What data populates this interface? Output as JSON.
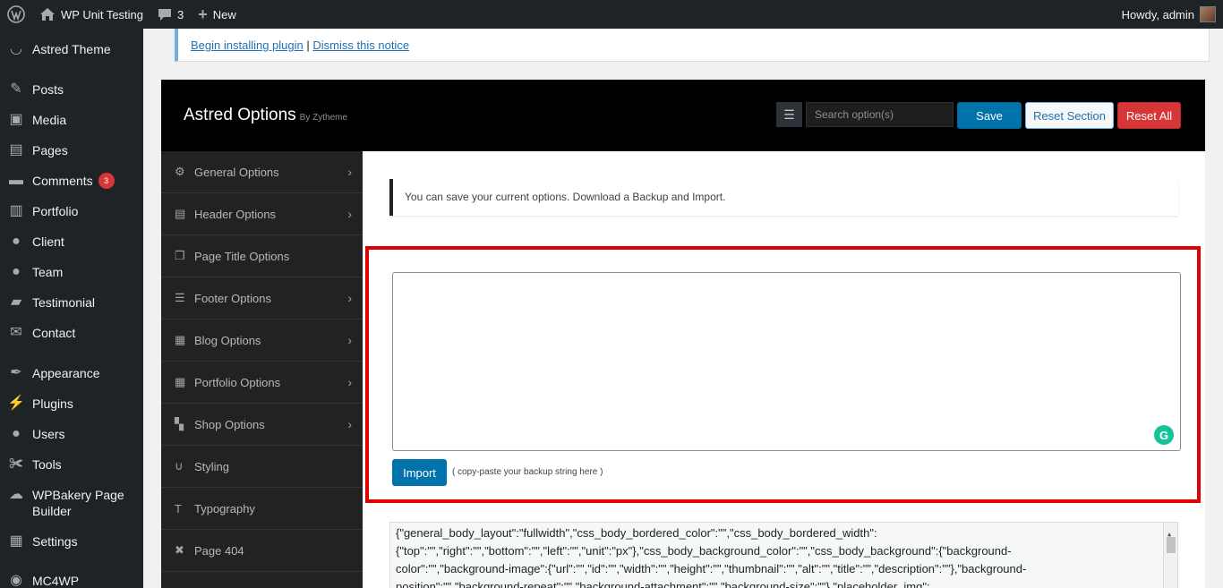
{
  "adminbar": {
    "wp_logo": "wordpress-icon",
    "site_name": "WP Unit Testing",
    "comments_count": "3",
    "new_label": "New",
    "howdy": "Howdy, admin"
  },
  "sidebar": {
    "items": [
      {
        "label": "Astred Theme",
        "icon": "smile-icon"
      },
      {
        "label": "Posts",
        "icon": "pin-icon"
      },
      {
        "label": "Media",
        "icon": "media-icon"
      },
      {
        "label": "Pages",
        "icon": "pages-icon"
      },
      {
        "label": "Comments",
        "icon": "comment-icon",
        "badge": "3"
      },
      {
        "label": "Portfolio",
        "icon": "portfolio-icon"
      },
      {
        "label": "Client",
        "icon": "client-icon"
      },
      {
        "label": "Team",
        "icon": "team-icon"
      },
      {
        "label": "Testimonial",
        "icon": "testimonial-icon"
      },
      {
        "label": "Contact",
        "icon": "mail-icon"
      },
      {
        "label": "Appearance",
        "icon": "brush-icon"
      },
      {
        "label": "Plugins",
        "icon": "plug-icon"
      },
      {
        "label": "Users",
        "icon": "user-icon"
      },
      {
        "label": "Tools",
        "icon": "wrench-icon"
      },
      {
        "label": "WPBakery Page Builder",
        "icon": "wpbakery-icon"
      },
      {
        "label": "Settings",
        "icon": "settings-icon"
      },
      {
        "label": "MC4WP",
        "icon": "mc4wp-icon"
      }
    ]
  },
  "notice": {
    "begin_link": "Begin installing plugin",
    "separator": "|",
    "dismiss_link": "Dismiss this notice"
  },
  "options": {
    "title": "Astred Options",
    "by": "By Zytheme",
    "search_placeholder": "Search option(s)",
    "save_label": "Save",
    "reset_section_label": "Reset Section",
    "reset_all_label": "Reset All",
    "nav": [
      {
        "label": "General Options",
        "icon": "gears-icon",
        "chevron": true
      },
      {
        "label": "Header Options",
        "icon": "header-icon",
        "chevron": true
      },
      {
        "label": "Page Title Options",
        "icon": "copy-icon",
        "chevron": false
      },
      {
        "label": "Footer Options",
        "icon": "footer-icon",
        "chevron": true
      },
      {
        "label": "Blog Options",
        "icon": "grid-icon",
        "chevron": true
      },
      {
        "label": "Portfolio Options",
        "icon": "grid-icon",
        "chevron": true
      },
      {
        "label": "Shop Options",
        "icon": "cart-icon",
        "chevron": true
      },
      {
        "label": "Styling",
        "icon": "magnet-icon",
        "chevron": false
      },
      {
        "label": "Typography",
        "icon": "typography-icon",
        "chevron": false
      },
      {
        "label": "Page 404",
        "icon": "x-icon",
        "chevron": false
      }
    ],
    "info_text": "You can save your current options. Download a Backup and Import.",
    "import_label": "Import",
    "import_hint": "( copy-paste your backup string here )",
    "export_lines": [
      "{\"general_body_layout\":\"fullwidth\",\"css_body_bordered_color\":\"\",\"css_body_bordered_width\":",
      "{\"top\":\"\",\"right\":\"\",\"bottom\":\"\",\"left\":\"\",\"unit\":\"px\"},\"css_body_background_color\":\"\",\"css_body_background\":{\"background-",
      "color\":\"\",\"background-image\":{\"url\":\"\",\"id\":\"\",\"width\":\"\",\"height\":\"\",\"thumbnail\":\"\",\"alt\":\"\",\"title\":\"\",\"description\":\"\"},\"background-",
      "position\":\"\",\"background-repeat\":\"\",\"background-attachment\":\"\",\"background-size\":\"\"},\"placeholder_img\":"
    ]
  }
}
